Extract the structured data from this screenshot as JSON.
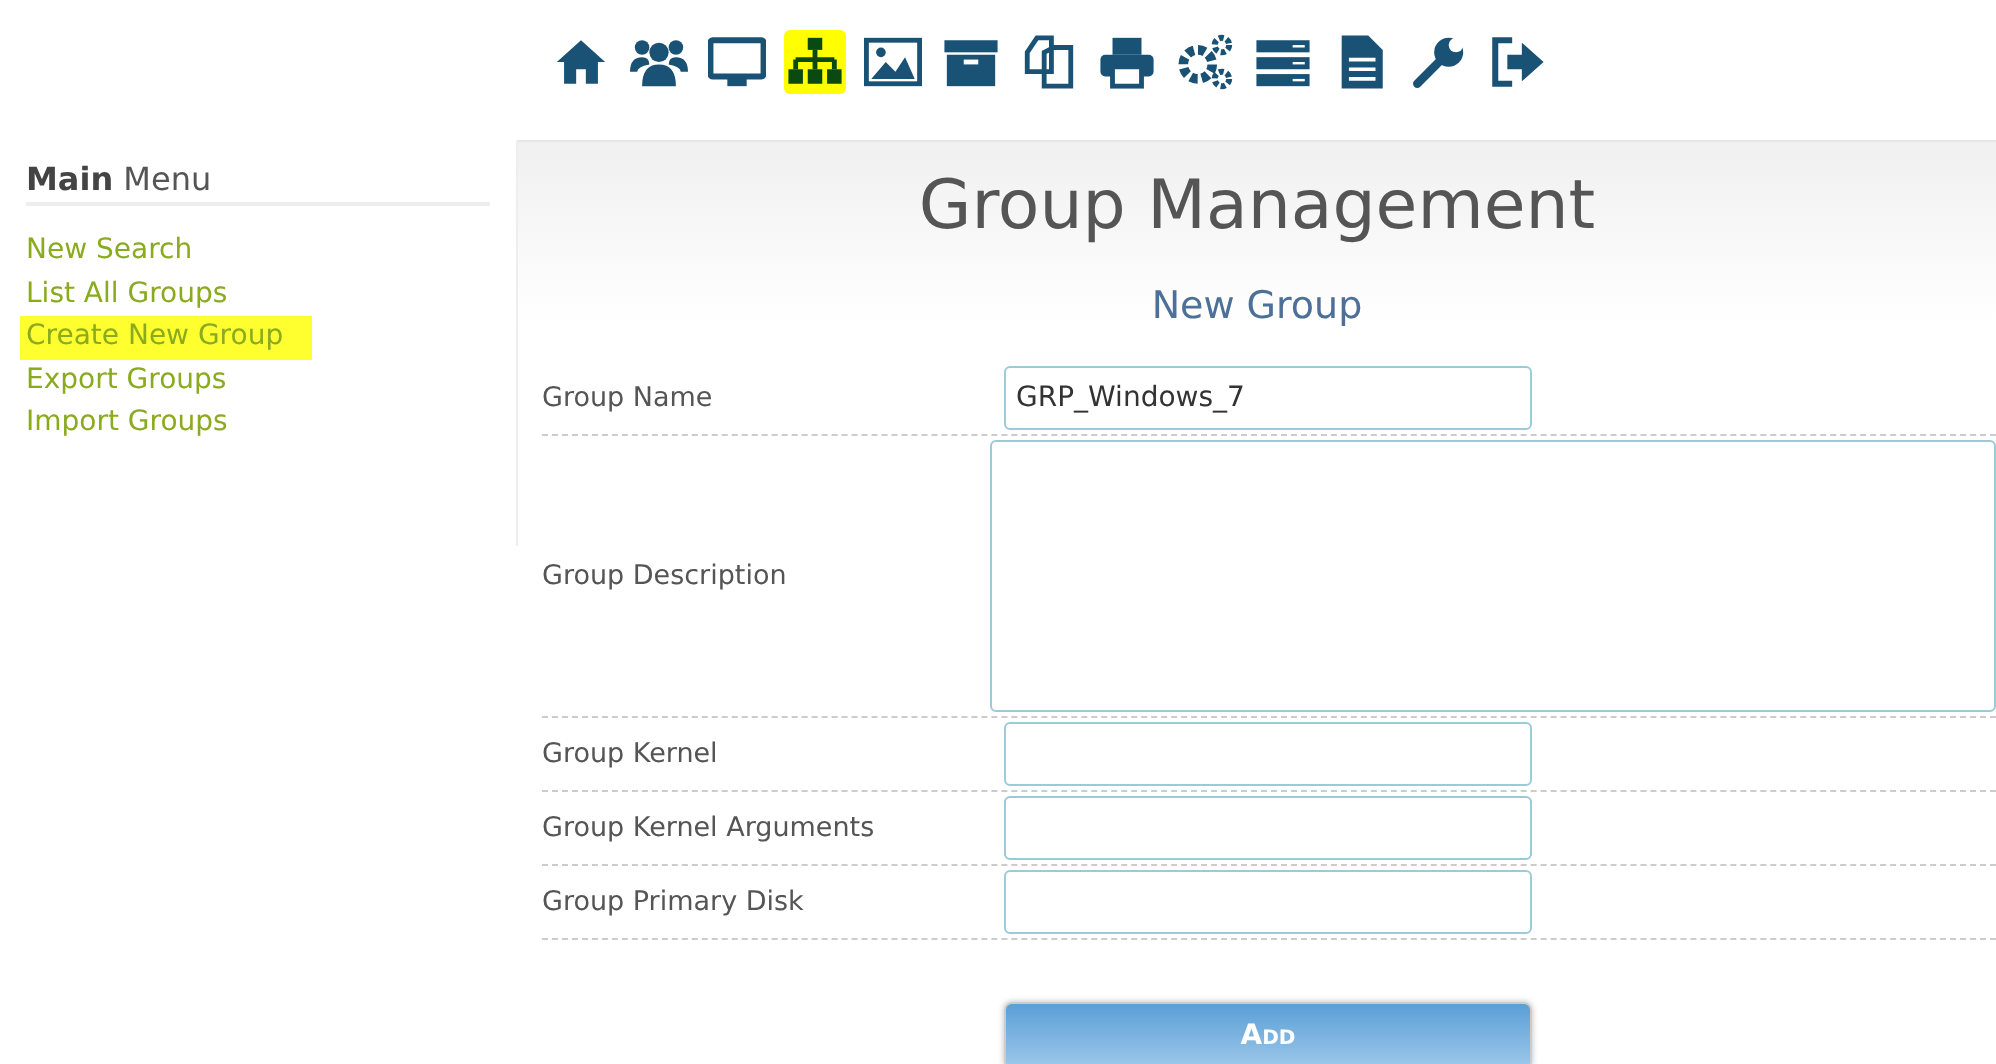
{
  "toolbar": [
    {
      "kind": "home",
      "selected": false
    },
    {
      "kind": "users",
      "selected": false
    },
    {
      "kind": "monitor",
      "selected": false
    },
    {
      "kind": "sitemap",
      "selected": true
    },
    {
      "kind": "image",
      "selected": false
    },
    {
      "kind": "archive",
      "selected": false
    },
    {
      "kind": "copy",
      "selected": false
    },
    {
      "kind": "printer",
      "selected": false
    },
    {
      "kind": "gears",
      "selected": false
    },
    {
      "kind": "server",
      "selected": false
    },
    {
      "kind": "document",
      "selected": false
    },
    {
      "kind": "wrench",
      "selected": false
    },
    {
      "kind": "logout",
      "selected": false
    }
  ],
  "sidebar": {
    "title_bold": "Main",
    "title_rest": "Menu",
    "items": [
      {
        "label": "New Search",
        "selected": false
      },
      {
        "label": "List All Groups",
        "selected": false
      },
      {
        "label": "Create New Group",
        "selected": true
      },
      {
        "label": "Export Groups",
        "selected": false
      },
      {
        "label": "Import Groups",
        "selected": false
      }
    ]
  },
  "page_title": "Group Management",
  "form": {
    "title": "New Group",
    "fields": [
      {
        "label": "Group Name",
        "kind": "input",
        "value": "GRP_Windows_7"
      },
      {
        "label": "Group Description",
        "kind": "textarea"
      },
      {
        "label": "Group Kernel",
        "kind": "input"
      },
      {
        "label": "Group Kernel Arguments",
        "kind": "input"
      },
      {
        "label": "Group Primary Disk",
        "kind": "input"
      }
    ],
    "submit": "Add"
  }
}
